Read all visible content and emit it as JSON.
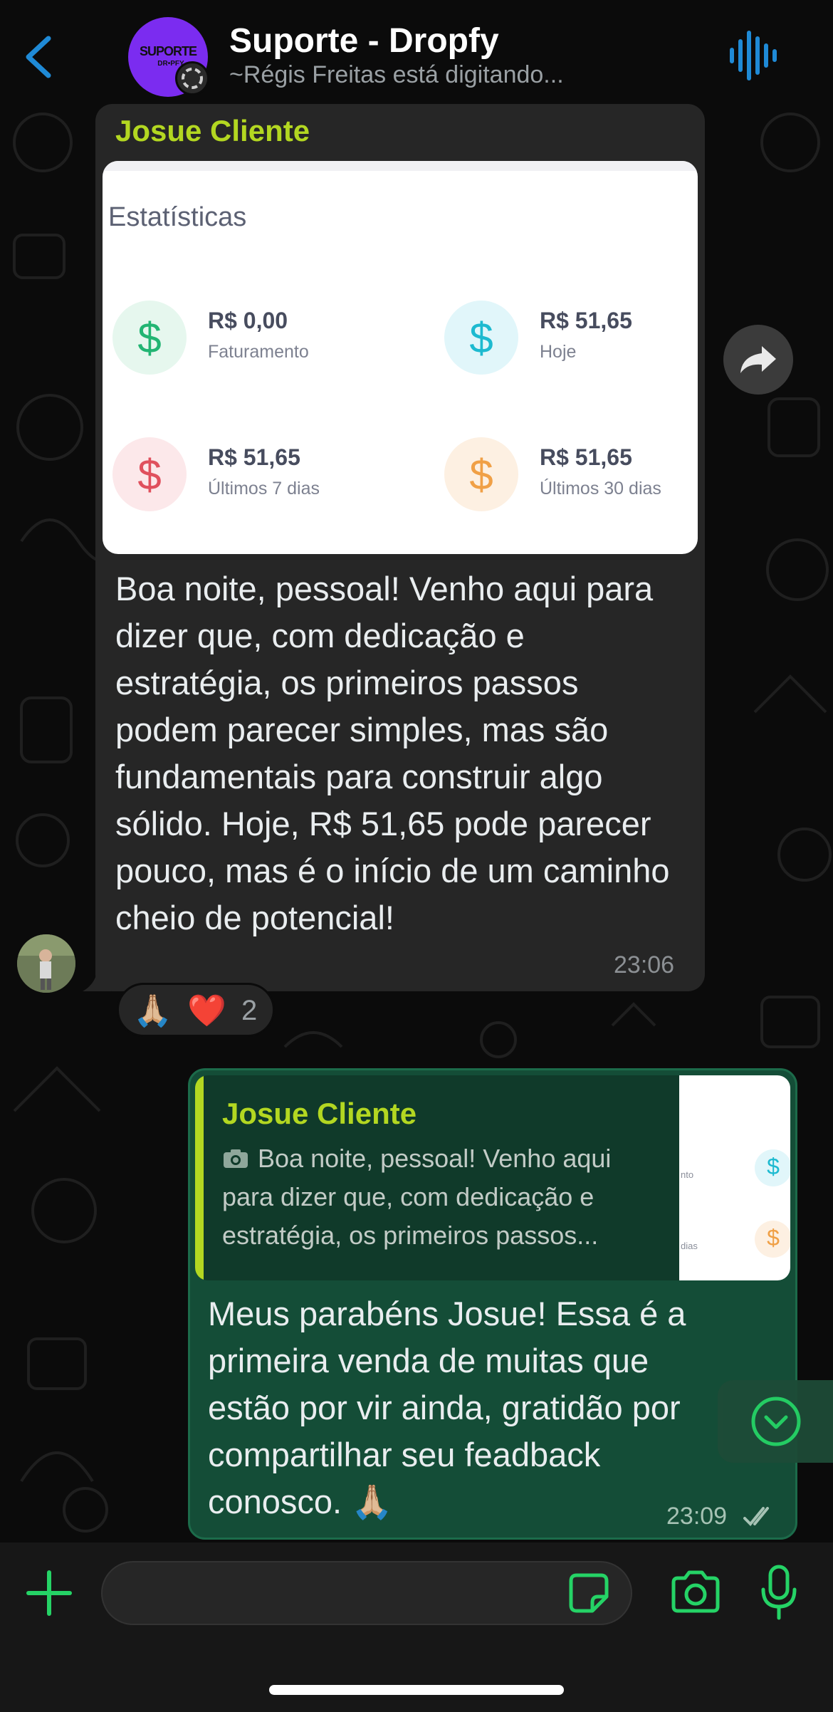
{
  "colors": {
    "accent_blue": "#1f8ad6",
    "accent_green": "#25d366",
    "sender_name": "#b3d721",
    "incoming_bubble": "#262626",
    "outgoing_bubble": "#144d37"
  },
  "header": {
    "back_icon": "chevron-left-icon",
    "avatar_logo_text": "SUPORTE",
    "avatar_logo_sub": "DR•PFY",
    "title": "Suporte - Dropfy",
    "subtitle": "~Régis Freitas está digitando...",
    "call_icon": "audio-wave-icon"
  },
  "incoming_message": {
    "sender": "Josue Cliente",
    "image": {
      "title": "Estatísticas",
      "stats": [
        {
          "value": "R$ 0,00",
          "label": "Faturamento",
          "color": "#22b573",
          "bg": "#e6f7ee"
        },
        {
          "value": "R$ 51,65",
          "label": "Hoje",
          "color": "#1dbad0",
          "bg": "#e1f6fa"
        },
        {
          "value": "R$ 51,65",
          "label": "Últimos 7 dias",
          "color": "#e0505d",
          "bg": "#fce8ea"
        },
        {
          "value": "R$ 51,65",
          "label": "Últimos 30 dias",
          "color": "#f0a046",
          "bg": "#fdf0e2"
        }
      ]
    },
    "text": "Boa noite, pessoal! Venho aqui para dizer que, com dedicação e estratégia, os primeiros passos podem parecer simples, mas são fundamentais para construir algo sólido. Hoje, R$ 51,65 pode parecer pouco, mas é o início de um caminho cheio de potencial!",
    "time": "23:06",
    "reactions": {
      "emoji_1": "🙏🏼",
      "emoji_2": "❤️",
      "count": "2"
    }
  },
  "outgoing_message": {
    "quote": {
      "sender": "Josue Cliente",
      "text": "Boa noite, pessoal! Venho aqui para dizer que, com dedicação e estratégia, os primeiros passos...",
      "thumb_fragment_1": "nto",
      "thumb_fragment_2": "dias"
    },
    "text": "Meus parabéns Josue! Essa é a primeira venda de muitas que estão por vir ainda, gratidão por compartilhar seu feadback conosco. 🙏🏼",
    "time": "23:09",
    "status_icon": "double-check-icon"
  },
  "composer": {
    "input_value": "",
    "input_placeholder": "",
    "plus_icon": "plus-icon",
    "sticker_icon": "sticker-icon",
    "camera_icon": "camera-icon",
    "mic_icon": "microphone-icon"
  }
}
